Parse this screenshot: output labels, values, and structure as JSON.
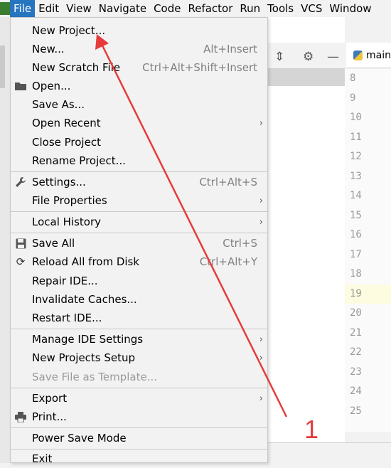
{
  "menubar": {
    "items": [
      {
        "label": "File",
        "active": true
      },
      {
        "label": "Edit"
      },
      {
        "label": "View"
      },
      {
        "label": "Navigate"
      },
      {
        "label": "Code"
      },
      {
        "label": "Refactor"
      },
      {
        "label": "Run"
      },
      {
        "label": "Tools"
      },
      {
        "label": "VCS"
      },
      {
        "label": "Window"
      }
    ]
  },
  "file_menu": {
    "new_project": "New Project...",
    "new": {
      "label": "New...",
      "shortcut": "Alt+Insert"
    },
    "new_scratch": {
      "label": "New Scratch File",
      "shortcut": "Ctrl+Alt+Shift+Insert"
    },
    "open": "Open...",
    "save_as": "Save As...",
    "open_recent": "Open Recent",
    "close_project": "Close Project",
    "rename_project": "Rename Project...",
    "settings": {
      "label": "Settings...",
      "shortcut": "Ctrl+Alt+S"
    },
    "file_properties": "File Properties",
    "local_history": "Local History",
    "save_all": {
      "label": "Save All",
      "shortcut": "Ctrl+S"
    },
    "reload_all": {
      "label": "Reload All from Disk",
      "shortcut": "Ctrl+Alt+Y"
    },
    "repair_ide": "Repair IDE...",
    "invalidate_caches": "Invalidate Caches...",
    "restart_ide": "Restart IDE...",
    "manage_ide_settings": "Manage IDE Settings",
    "new_projects_setup": "New Projects Setup",
    "save_as_template": "Save File as Template...",
    "export": "Export",
    "print": "Print...",
    "power_save": "Power Save Mode",
    "exit": "Exit"
  },
  "editor": {
    "tab_label": "main",
    "line_numbers": [
      "8",
      "9",
      "10",
      "11",
      "12",
      "13",
      "14",
      "15",
      "16",
      "17",
      "18",
      "19",
      "20",
      "21",
      "22",
      "23",
      "24",
      "25"
    ]
  },
  "annotation": {
    "label": "1",
    "color": "#e63b3b"
  },
  "colors": {
    "menu_active": "#2675bf",
    "menu_bg": "#f2f2f2"
  }
}
